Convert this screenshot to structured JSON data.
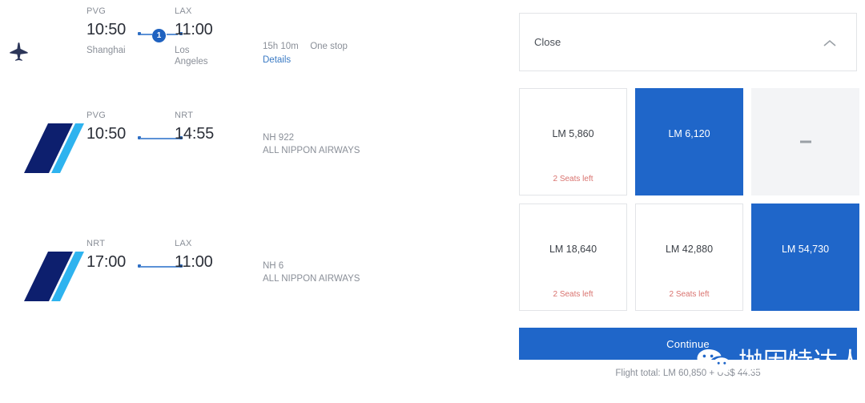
{
  "itinerary": {
    "summary": {
      "icon": "airplane-icon",
      "departure": {
        "code": "PVG",
        "time": "10:50",
        "city": "Shanghai"
      },
      "arrival": {
        "code": "LAX",
        "time": "11:00",
        "city": "Los Angeles"
      },
      "stops_badge": "1",
      "duration": "15h 10m",
      "stops_label": "One stop",
      "details_link": "Details"
    },
    "segments": [
      {
        "logo": "ana-logo",
        "departure": {
          "code": "PVG",
          "time": "10:50"
        },
        "arrival": {
          "code": "NRT",
          "time": "14:55"
        },
        "flight_number": "NH 922",
        "airline": "ALL NIPPON AIRWAYS"
      },
      {
        "logo": "ana-logo",
        "departure": {
          "code": "NRT",
          "time": "17:00"
        },
        "arrival": {
          "code": "LAX",
          "time": "11:00"
        },
        "flight_number": "NH 6",
        "airline": "ALL NIPPON AIRWAYS"
      }
    ]
  },
  "panel": {
    "close_label": "Close",
    "collapse_icon": "chevron-up-icon",
    "fares": [
      {
        "price": "LM 5,860",
        "seats": "2 Seats left",
        "state": "available"
      },
      {
        "price": "LM 6,120",
        "seats": "",
        "state": "selected"
      },
      {
        "price": "",
        "seats": "",
        "state": "unavailable"
      },
      {
        "price": "LM 18,640",
        "seats": "2 Seats left",
        "state": "available"
      },
      {
        "price": "LM 42,880",
        "seats": "2 Seats left",
        "state": "available"
      },
      {
        "price": "LM 54,730",
        "seats": "",
        "state": "selected"
      }
    ],
    "continue_label": "Continue",
    "flight_total": "Flight total: LM 60,850 + US$ 44.35"
  },
  "watermark": {
    "icon": "wechat-icon",
    "text": "抛因特达人"
  },
  "colors": {
    "accent_blue": "#1f66c9",
    "link_blue": "#3a7ac4",
    "ana_navy": "#0d1f6e",
    "ana_cyan": "#2eb3ef",
    "seats_red": "#d9736f",
    "muted_grey": "#8a8f98"
  }
}
